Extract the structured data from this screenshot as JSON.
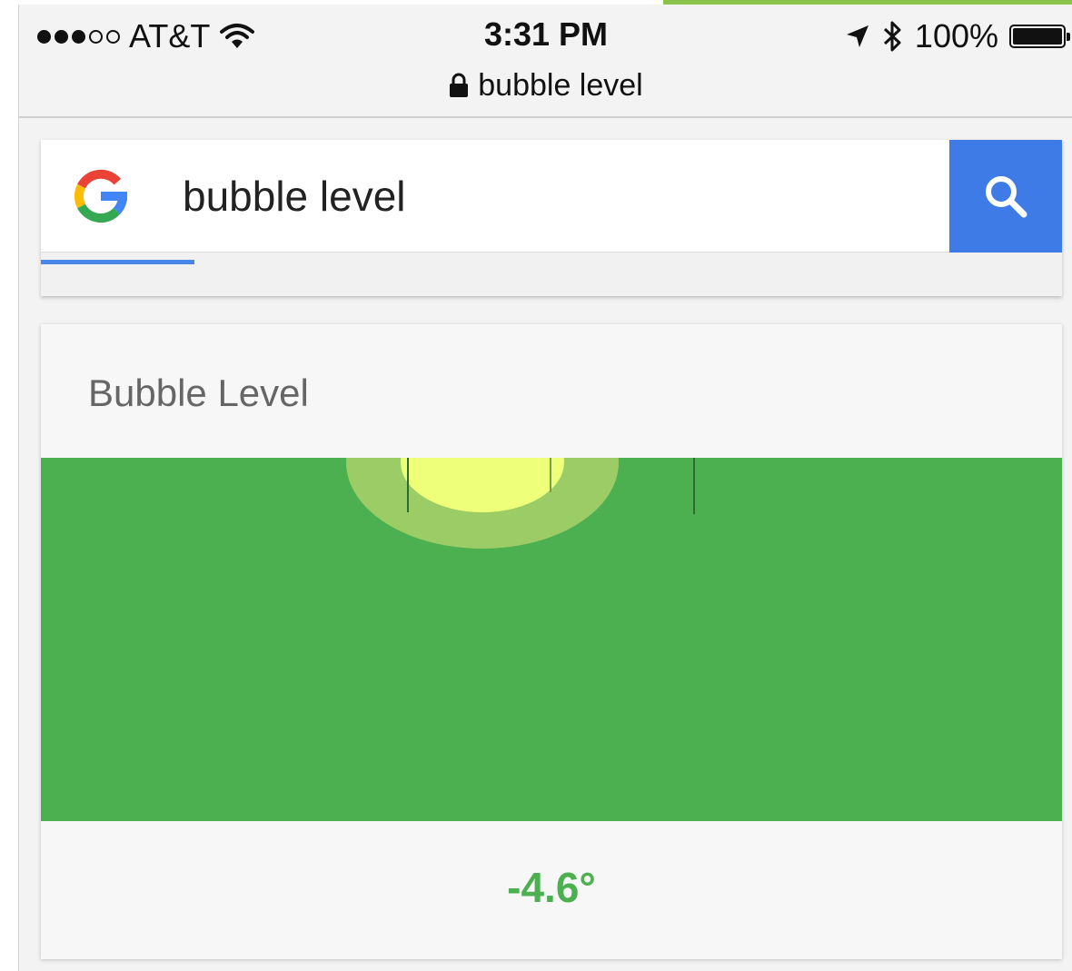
{
  "status_bar": {
    "signal_bars": 3,
    "signal_total": 5,
    "carrier": "AT&T",
    "time": "3:31 PM",
    "battery_percent": "100%",
    "battery_level": 1.0
  },
  "browser": {
    "url": "bubble level"
  },
  "search": {
    "query": "bubble level",
    "load_progress": 0.15,
    "search_button_icon": "search-icon",
    "logo_icon": "google-g-icon"
  },
  "widget": {
    "title": "Bubble Level",
    "angle_reading": "-4.6°",
    "angle_degrees": -4.6
  },
  "colors": {
    "level_green": "#4caf50",
    "bubble_outer": "#9ccc65",
    "bubble_inner": "#eeff7a",
    "google_blue": "#4285f4",
    "google_red": "#ea4335",
    "google_yellow": "#fbbc05",
    "google_green": "#34a853",
    "search_button_blue": "#3f7be7"
  },
  "icons": [
    "wifi-icon",
    "lock-icon",
    "location-arrow-icon",
    "bluetooth-icon",
    "battery-icon"
  ]
}
